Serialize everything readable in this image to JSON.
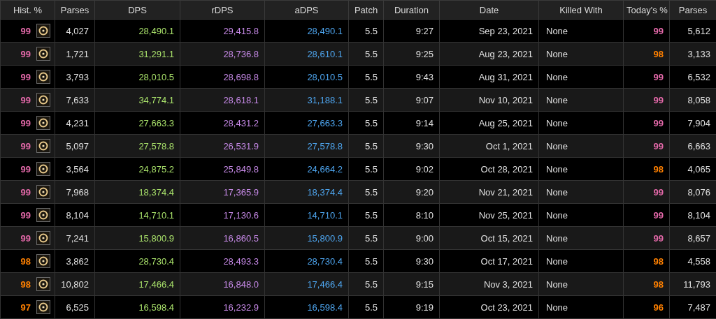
{
  "table": {
    "columns": [
      "Hist. %",
      "Parses",
      "DPS",
      "rDPS",
      "aDPS",
      "Patch",
      "Duration",
      "Date",
      "Killed With",
      "Today's %",
      "Parses"
    ],
    "rows": [
      {
        "hist": {
          "text": "99",
          "color": "#e268a8"
        },
        "parses": "4,027",
        "dps": "28,490.1",
        "rdps": "29,415.8",
        "adps": "28,490.1",
        "patch": "5.5",
        "duration": "9:27",
        "date": "Sep 23, 2021",
        "killed_with": "None",
        "today": {
          "text": "99",
          "color": "#e268a8"
        },
        "today_parses": "5,612"
      },
      {
        "hist": {
          "text": "99",
          "color": "#e268a8"
        },
        "parses": "1,721",
        "dps": "31,291.1",
        "rdps": "28,736.8",
        "adps": "28,610.1",
        "patch": "5.5",
        "duration": "9:25",
        "date": "Aug 23, 2021",
        "killed_with": "None",
        "today": {
          "text": "98",
          "color": "#ff8000"
        },
        "today_parses": "3,133"
      },
      {
        "hist": {
          "text": "99",
          "color": "#e268a8"
        },
        "parses": "3,793",
        "dps": "28,010.5",
        "rdps": "28,698.8",
        "adps": "28,010.5",
        "patch": "5.5",
        "duration": "9:43",
        "date": "Aug 31, 2021",
        "killed_with": "None",
        "today": {
          "text": "99",
          "color": "#e268a8"
        },
        "today_parses": "6,532"
      },
      {
        "hist": {
          "text": "99",
          "color": "#e268a8"
        },
        "parses": "7,633",
        "dps": "34,774.1",
        "rdps": "28,618.1",
        "adps": "31,188.1",
        "patch": "5.5",
        "duration": "9:07",
        "date": "Nov 10, 2021",
        "killed_with": "None",
        "today": {
          "text": "99",
          "color": "#e268a8"
        },
        "today_parses": "8,058"
      },
      {
        "hist": {
          "text": "99",
          "color": "#e268a8"
        },
        "parses": "4,231",
        "dps": "27,663.3",
        "rdps": "28,431.2",
        "adps": "27,663.3",
        "patch": "5.5",
        "duration": "9:14",
        "date": "Aug 25, 2021",
        "killed_with": "None",
        "today": {
          "text": "99",
          "color": "#e268a8"
        },
        "today_parses": "7,904"
      },
      {
        "hist": {
          "text": "99",
          "color": "#e268a8"
        },
        "parses": "5,097",
        "dps": "27,578.8",
        "rdps": "26,531.9",
        "adps": "27,578.8",
        "patch": "5.5",
        "duration": "9:30",
        "date": "Oct 1, 2021",
        "killed_with": "None",
        "today": {
          "text": "99",
          "color": "#e268a8"
        },
        "today_parses": "6,663"
      },
      {
        "hist": {
          "text": "99",
          "color": "#e268a8"
        },
        "parses": "3,564",
        "dps": "24,875.2",
        "rdps": "25,849.8",
        "adps": "24,664.2",
        "patch": "5.5",
        "duration": "9:02",
        "date": "Oct 28, 2021",
        "killed_with": "None",
        "today": {
          "text": "98",
          "color": "#ff8000"
        },
        "today_parses": "4,065"
      },
      {
        "hist": {
          "text": "99",
          "color": "#e268a8"
        },
        "parses": "7,968",
        "dps": "18,374.4",
        "rdps": "17,365.9",
        "adps": "18,374.4",
        "patch": "5.5",
        "duration": "9:20",
        "date": "Nov 21, 2021",
        "killed_with": "None",
        "today": {
          "text": "99",
          "color": "#e268a8"
        },
        "today_parses": "8,076"
      },
      {
        "hist": {
          "text": "99",
          "color": "#e268a8"
        },
        "parses": "8,104",
        "dps": "14,710.1",
        "rdps": "17,130.6",
        "adps": "14,710.1",
        "patch": "5.5",
        "duration": "8:10",
        "date": "Nov 25, 2021",
        "killed_with": "None",
        "today": {
          "text": "99",
          "color": "#e268a8"
        },
        "today_parses": "8,104"
      },
      {
        "hist": {
          "text": "99",
          "color": "#e268a8"
        },
        "parses": "7,241",
        "dps": "15,800.9",
        "rdps": "16,860.5",
        "adps": "15,800.9",
        "patch": "5.5",
        "duration": "9:00",
        "date": "Oct 15, 2021",
        "killed_with": "None",
        "today": {
          "text": "99",
          "color": "#e268a8"
        },
        "today_parses": "8,657"
      },
      {
        "hist": {
          "text": "98",
          "color": "#ff8000"
        },
        "parses": "3,862",
        "dps": "28,730.4",
        "rdps": "28,493.3",
        "adps": "28,730.4",
        "patch": "5.5",
        "duration": "9:30",
        "date": "Oct 17, 2021",
        "killed_with": "None",
        "today": {
          "text": "98",
          "color": "#ff8000"
        },
        "today_parses": "4,558"
      },
      {
        "hist": {
          "text": "98",
          "color": "#ff8000"
        },
        "parses": "10,802",
        "dps": "17,466.4",
        "rdps": "16,848.0",
        "adps": "17,466.4",
        "patch": "5.5",
        "duration": "9:15",
        "date": "Nov 3, 2021",
        "killed_with": "None",
        "today": {
          "text": "98",
          "color": "#ff8000"
        },
        "today_parses": "11,793"
      },
      {
        "hist": {
          "text": "97",
          "color": "#ff8000"
        },
        "parses": "6,525",
        "dps": "16,598.4",
        "rdps": "16,232.9",
        "adps": "16,598.4",
        "patch": "5.5",
        "duration": "9:19",
        "date": "Oct 23, 2021",
        "killed_with": "None",
        "today": {
          "text": "96",
          "color": "#ff8000"
        },
        "today_parses": "7,487"
      }
    ]
  }
}
